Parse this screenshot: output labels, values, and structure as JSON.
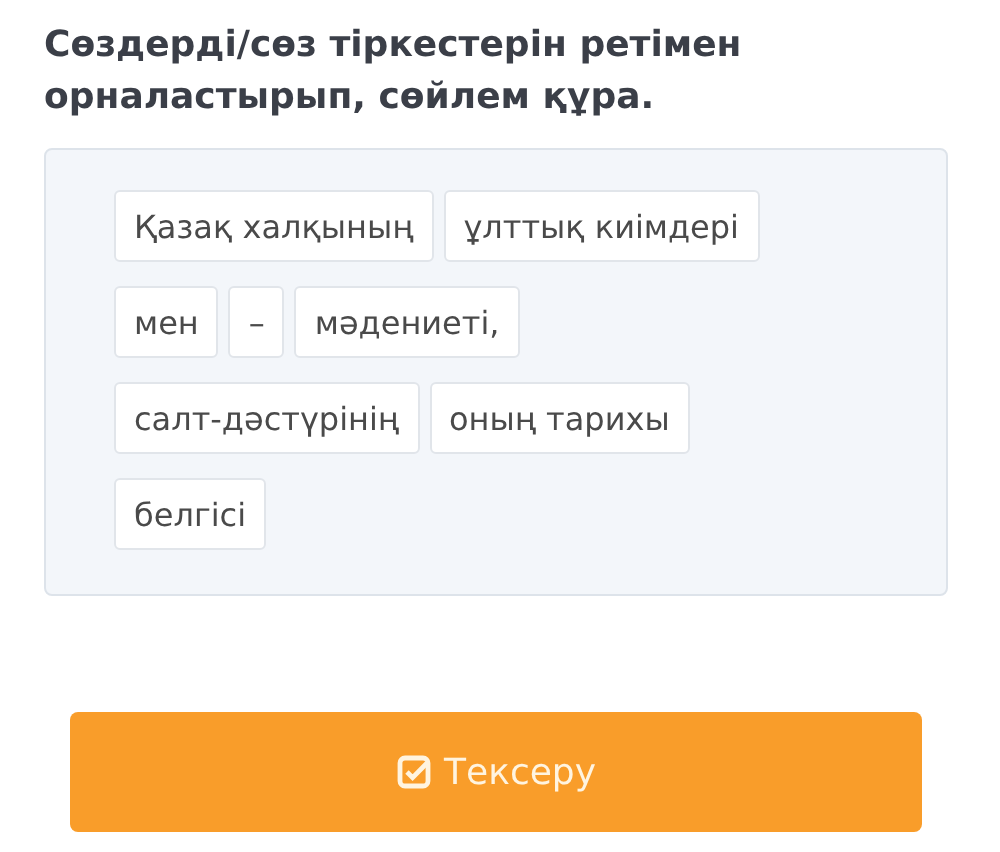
{
  "question": {
    "title": "Сөздерді/сөз тіркестерін ретімен орналастырып, сөйлем құра."
  },
  "word_rows": [
    [
      "Қазақ халқының",
      "ұлттық киімдері"
    ],
    [
      "мен",
      "–",
      "мәдениеті,"
    ],
    [
      "салт-дәстүрінің",
      "оның тарихы"
    ],
    [
      "белгісі"
    ]
  ],
  "check_button": {
    "label": "Тексеру"
  }
}
